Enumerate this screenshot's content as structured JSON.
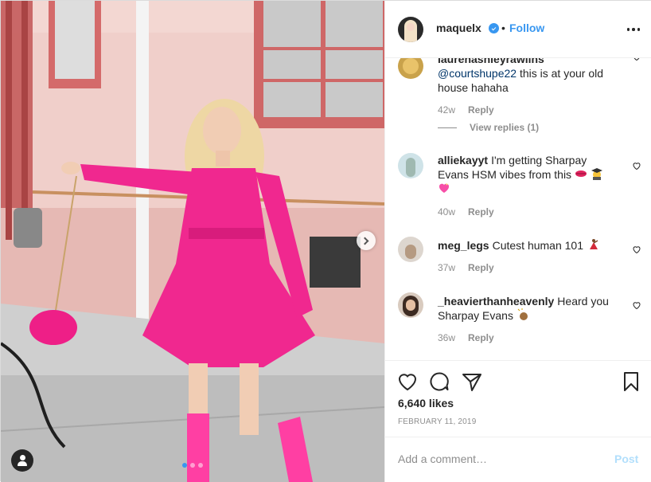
{
  "header": {
    "username": "maquelx",
    "follow_label": "Follow",
    "separator": "•"
  },
  "comments": [
    {
      "username": "laurenashleyrawlins",
      "mention": "@courtshupe22",
      "text": " this is at your old house hahaha",
      "age": "42w",
      "reply_label": "Reply",
      "view_replies": "View replies (1)"
    },
    {
      "username": "alliekayyt",
      "text": "I'm getting Sharpay Evans HSM vibes from this",
      "emoji_names": [
        "lips-emoji",
        "graduate-emoji",
        "sparkling-heart-emoji"
      ],
      "age": "40w",
      "reply_label": "Reply"
    },
    {
      "username": "meg_legs",
      "text": "Cutest human 101",
      "emoji_names": [
        "dancer-emoji"
      ],
      "age": "37w",
      "reply_label": "Reply"
    },
    {
      "username": "_heavierthanheavenly",
      "text": "Heard you Sharpay Evans",
      "emoji_names": [
        "clapping-emoji"
      ],
      "age": "36w",
      "reply_label": "Reply"
    }
  ],
  "likes": "6,640 likes",
  "date": "February 11, 2019",
  "add_comment": {
    "placeholder": "Add a comment…",
    "post_label": "Post"
  },
  "carousel": {
    "slide_count": 3,
    "active_index": 0
  },
  "colors": {
    "accent": "#3897f0",
    "dress": "#f0288f",
    "post_disabled": "#b2dffc",
    "muted": "#8e8e8e"
  },
  "icons": [
    "heart-icon",
    "comment-icon",
    "share-icon",
    "bookmark-icon",
    "more-options-icon",
    "verified-badge-icon",
    "next-arrow-icon",
    "tag-user-icon"
  ]
}
